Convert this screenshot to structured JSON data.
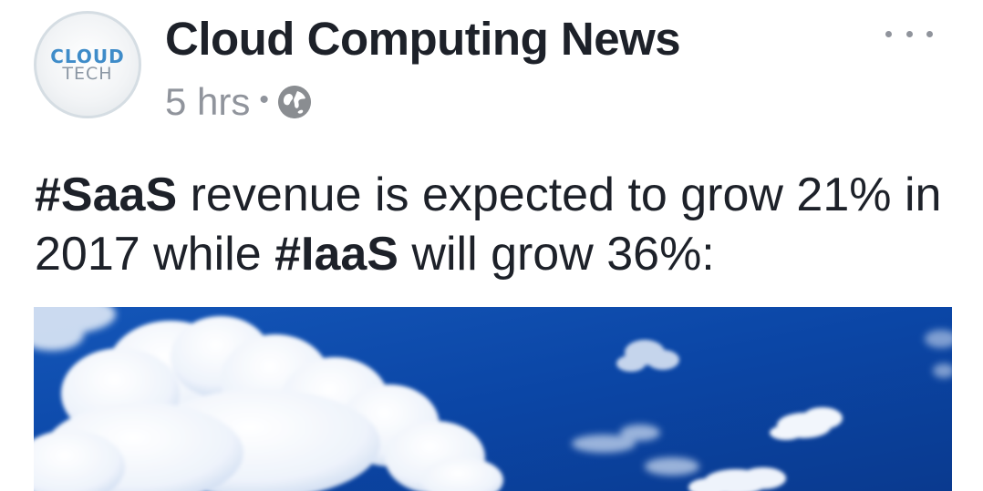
{
  "post": {
    "avatar": {
      "line1": "CLOUD",
      "line2": "TECH"
    },
    "page_name": "Cloud Computing News",
    "timestamp": "5 hrs",
    "separator": "•",
    "privacy_icon": "globe-icon",
    "more_icon": "more-options-icon",
    "message": {
      "segments": [
        {
          "text": "#SaaS",
          "bold": true
        },
        {
          "text": " revenue is expected to grow 21% in 2017 while ",
          "bold": false
        },
        {
          "text": "#IaaS",
          "bold": true
        },
        {
          "text": " will grow 36%:",
          "bold": false
        }
      ]
    },
    "image": {
      "subject": "clouds-in-blue-sky"
    }
  },
  "colors": {
    "text_primary": "#1d2129",
    "text_secondary": "#90949c",
    "brand_blue": "#3f8cc9",
    "sky_blue": "#0e4fb0"
  }
}
